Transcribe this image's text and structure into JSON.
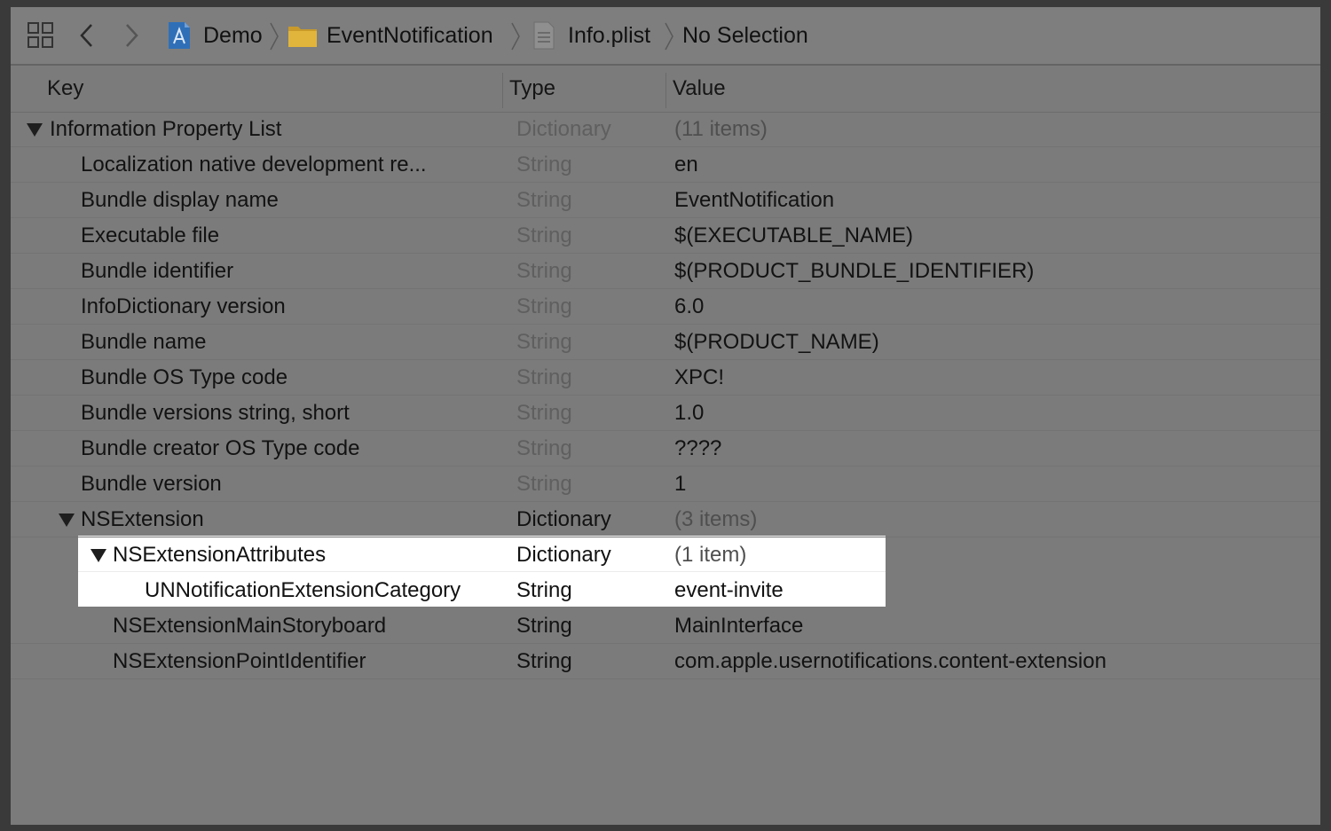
{
  "breadcrumb": {
    "items": [
      {
        "label": "Demo",
        "icon": "xcode-project-icon"
      },
      {
        "label": "EventNotification",
        "icon": "folder-icon"
      },
      {
        "label": "Info.plist",
        "icon": "plist-file-icon"
      },
      {
        "label": "No Selection",
        "icon": ""
      }
    ]
  },
  "columns": {
    "key": "Key",
    "type": "Type",
    "value": "Value"
  },
  "rows": [
    {
      "key": "Information Property List",
      "type": "Dictionary",
      "value": "(11 items)",
      "indent": 0,
      "disclosure": true,
      "type_dim": true,
      "value_dim": true,
      "highlight": false
    },
    {
      "key": "Localization native development re...",
      "type": "String",
      "value": "en",
      "indent": 1,
      "disclosure": false,
      "type_dim": true,
      "value_dim": false,
      "highlight": false
    },
    {
      "key": "Bundle display name",
      "type": "String",
      "value": "EventNotification",
      "indent": 1,
      "disclosure": false,
      "type_dim": true,
      "value_dim": false,
      "highlight": false
    },
    {
      "key": "Executable file",
      "type": "String",
      "value": "$(EXECUTABLE_NAME)",
      "indent": 1,
      "disclosure": false,
      "type_dim": true,
      "value_dim": false,
      "highlight": false
    },
    {
      "key": "Bundle identifier",
      "type": "String",
      "value": "$(PRODUCT_BUNDLE_IDENTIFIER)",
      "indent": 1,
      "disclosure": false,
      "type_dim": true,
      "value_dim": false,
      "highlight": false
    },
    {
      "key": "InfoDictionary version",
      "type": "String",
      "value": "6.0",
      "indent": 1,
      "disclosure": false,
      "type_dim": true,
      "value_dim": false,
      "highlight": false
    },
    {
      "key": "Bundle name",
      "type": "String",
      "value": "$(PRODUCT_NAME)",
      "indent": 1,
      "disclosure": false,
      "type_dim": true,
      "value_dim": false,
      "highlight": false
    },
    {
      "key": "Bundle OS Type code",
      "type": "String",
      "value": "XPC!",
      "indent": 1,
      "disclosure": false,
      "type_dim": true,
      "value_dim": false,
      "highlight": false
    },
    {
      "key": "Bundle versions string, short",
      "type": "String",
      "value": "1.0",
      "indent": 1,
      "disclosure": false,
      "type_dim": true,
      "value_dim": false,
      "highlight": false
    },
    {
      "key": "Bundle creator OS Type code",
      "type": "String",
      "value": "????",
      "indent": 1,
      "disclosure": false,
      "type_dim": true,
      "value_dim": false,
      "highlight": false
    },
    {
      "key": "Bundle version",
      "type": "String",
      "value": "1",
      "indent": 1,
      "disclosure": false,
      "type_dim": true,
      "value_dim": false,
      "highlight": false
    },
    {
      "key": "NSExtension",
      "type": "Dictionary",
      "value": "(3 items)",
      "indent": 1,
      "disclosure": true,
      "type_dim": false,
      "value_dim": true,
      "highlight": false
    },
    {
      "key": "NSExtensionAttributes",
      "type": "Dictionary",
      "value": "(1 item)",
      "indent": 2,
      "disclosure": true,
      "type_dim": false,
      "value_dim": true,
      "highlight": true
    },
    {
      "key": "UNNotificationExtensionCategory",
      "type": "String",
      "value": "event-invite",
      "indent": 3,
      "disclosure": false,
      "type_dim": false,
      "value_dim": false,
      "highlight": true
    },
    {
      "key": "NSExtensionMainStoryboard",
      "type": "String",
      "value": "MainInterface",
      "indent": 2,
      "disclosure": false,
      "type_dim": false,
      "value_dim": false,
      "highlight": false
    },
    {
      "key": "NSExtensionPointIdentifier",
      "type": "String",
      "value": "com.apple.usernotifications.content-extension",
      "indent": 2,
      "disclosure": false,
      "type_dim": false,
      "value_dim": false,
      "highlight": false
    }
  ]
}
